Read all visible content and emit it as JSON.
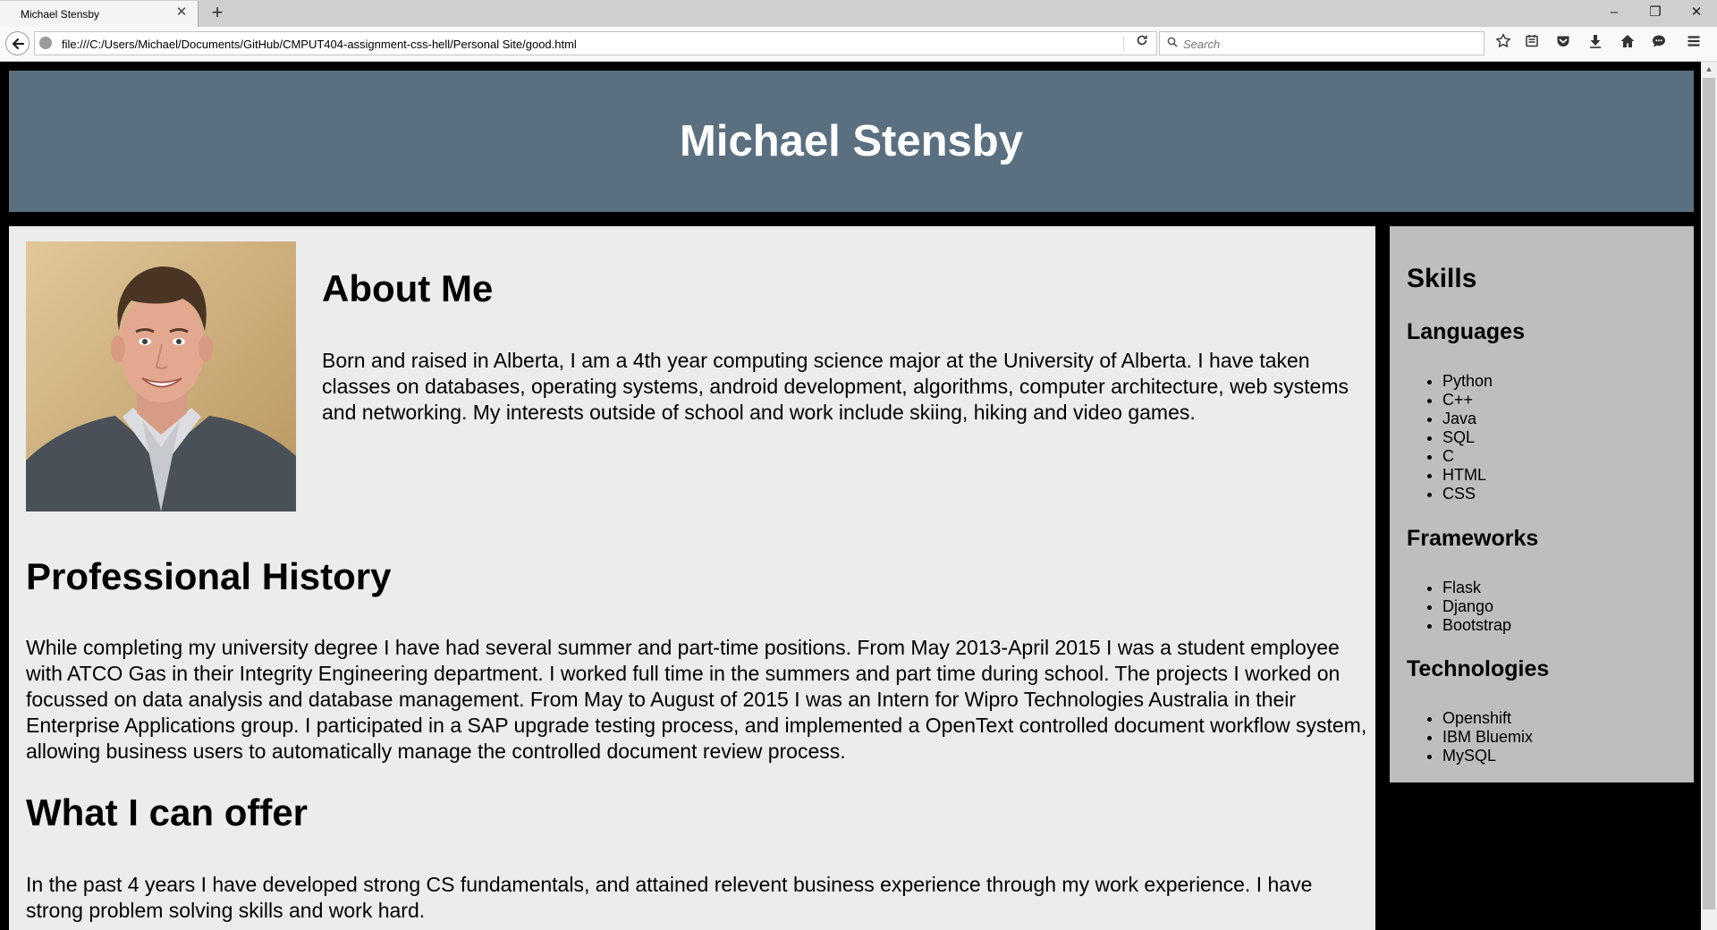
{
  "browser": {
    "tab_title": "Michael Stensby",
    "tab_close": "✕",
    "new_tab": "+",
    "window_controls": {
      "minimize": "–",
      "restore": "❐",
      "close": "✕"
    },
    "url": "file:///C:/Users/Michael/Documents/GitHub/CMPUT404-assignment-css-hell/Personal Site/good.html",
    "search_placeholder": "Search",
    "toolbar_icons": [
      "bookmark-star-icon",
      "reading-list-icon",
      "pocket-icon",
      "download-icon",
      "home-icon",
      "chat-icon",
      "menu-icon"
    ]
  },
  "page": {
    "header_title": "Michael Stensby",
    "about": {
      "heading": "About Me",
      "text": "Born and raised in Alberta, I am a 4th year computing science major at the University of Alberta. I have taken classes on databases, operating systems, android development, algorithms, computer architecture, web systems and networking. My interests outside of school and work include skiing, hiking and video games."
    },
    "history": {
      "heading": "Professional History",
      "text": "While completing my university degree I have had several summer and part-time positions. From May 2013-April 2015 I was a student employee with ATCO Gas in their Integrity Engineering department. I worked full time in the summers and part time during school. The projects I worked on focussed on data analysis and database management. From May to August of 2015 I was an Intern for Wipro Technologies Australia in their Enterprise Applications group. I participated in a SAP upgrade testing process, and implemented a OpenText controlled document workflow system, allowing business users to automatically manage the controlled document review process."
    },
    "offer": {
      "heading": "What I can offer",
      "text": "In the past 4 years I have developed strong CS fundamentals, and attained relevent business experience through my work experience. I have strong problem solving skills and work hard."
    },
    "skills": {
      "heading": "Skills",
      "languages_heading": "Languages",
      "languages": [
        "Python",
        "C++",
        "Java",
        "SQL",
        "C",
        "HTML",
        "CSS"
      ],
      "frameworks_heading": "Frameworks",
      "frameworks": [
        "Flask",
        "Django",
        "Bootstrap"
      ],
      "technologies_heading": "Technologies",
      "technologies": [
        "Openshift",
        "IBM Bluemix",
        "MySQL"
      ]
    }
  },
  "colors": {
    "header_bg": "#5a7080",
    "main_bg": "#ececec",
    "sidebar_bg": "#bebebe",
    "page_bg": "#000000"
  }
}
